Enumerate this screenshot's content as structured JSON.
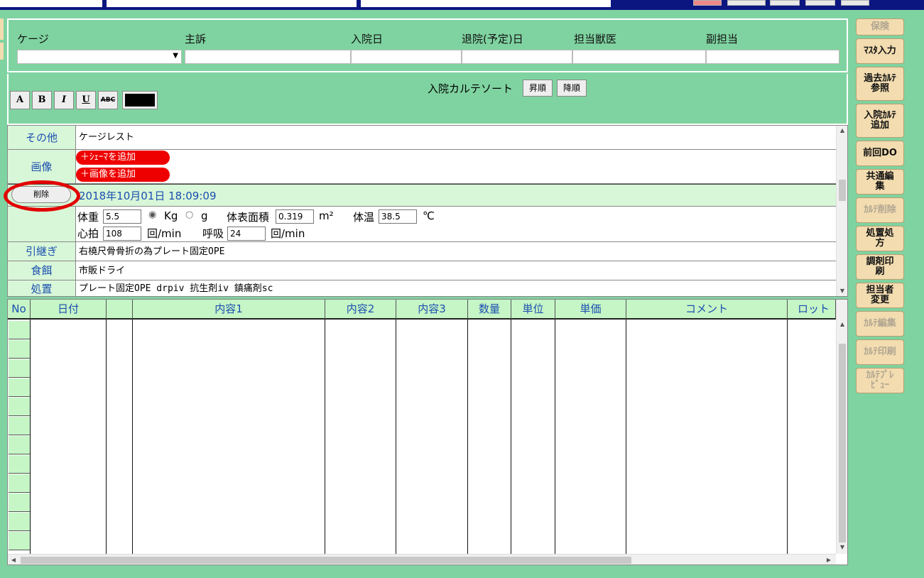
{
  "header": {
    "labels": {
      "cage": "ケージ",
      "complaint": "主訴",
      "admission": "入院日",
      "discharge": "退院(予定)日",
      "vet": "担当獣医",
      "sub_vet": "副担当"
    },
    "cage_select_value": ""
  },
  "toolbar": {
    "fmt_buttons": {
      "font": "A",
      "bold": "B",
      "italic": "I",
      "underline": "U",
      "strike": "ABC"
    },
    "text_color": "#000000",
    "sort_label": "入院カルテソート",
    "sort_asc": "昇順",
    "sort_desc": "降順"
  },
  "karte": {
    "rows": [
      {
        "label": "その他",
        "content": "ケージレスト"
      },
      {
        "label": "画像",
        "content": ""
      },
      {
        "label": "引継ぎ",
        "content": "右橈尺骨骨折の為プレート固定OPE"
      },
      {
        "label": "食餌",
        "content": "市販ドライ"
      },
      {
        "label": "処置",
        "content": "プレート固定OPE drpiv 抗生剤iv 鎮痛剤sc"
      }
    ],
    "add_schema": "＋ｼｪｰﾏを追加",
    "add_image": "＋画像を追加",
    "delete_label": "削除",
    "entry_datetime": "2018年10月01日 18:09:09",
    "vitals": {
      "weight_label": "体重",
      "weight": "5.5",
      "unit_kg": "Kg",
      "unit_g": "g",
      "bsa_label": "体表面積",
      "bsa": "0.319",
      "bsa_unit": "m²",
      "temp_label": "体温",
      "temp": "38.5",
      "temp_unit": "℃",
      "hr_label": "心拍",
      "hr": "108",
      "hr_unit": "回/min",
      "rr_label": "呼吸",
      "rr": "24",
      "rr_unit": "回/min",
      "selected_unit": "Kg"
    }
  },
  "table": {
    "columns": [
      "No",
      "日付",
      "",
      "内容1",
      "内容2",
      "内容3",
      "数量",
      "単位",
      "単価",
      "コメント",
      "ロット"
    ]
  },
  "side_buttons": [
    {
      "label": "保険",
      "enabled": false
    },
    {
      "label": "ﾏｽﾀ入力",
      "enabled": true
    },
    {
      "label": "過去ｶﾙﾃ参照",
      "enabled": true
    },
    {
      "label": "入院ｶﾙﾃ追加",
      "enabled": true
    },
    {
      "label": "前回DO",
      "enabled": true
    },
    {
      "label": "共通編集",
      "enabled": true
    },
    {
      "label": "ｶﾙﾃ削除",
      "enabled": false
    },
    {
      "label": "処置処方",
      "enabled": true
    },
    {
      "label": "調剤印刷",
      "enabled": true
    },
    {
      "label": "担当者変更",
      "enabled": true
    },
    {
      "label": "ｶﾙﾃ編集",
      "enabled": false
    },
    {
      "label": "ｶﾙﾃ印刷",
      "enabled": false
    },
    {
      "label": "ｶﾙﾃﾌﾟﾚﾋﾞｭｰ",
      "enabled": false
    }
  ]
}
